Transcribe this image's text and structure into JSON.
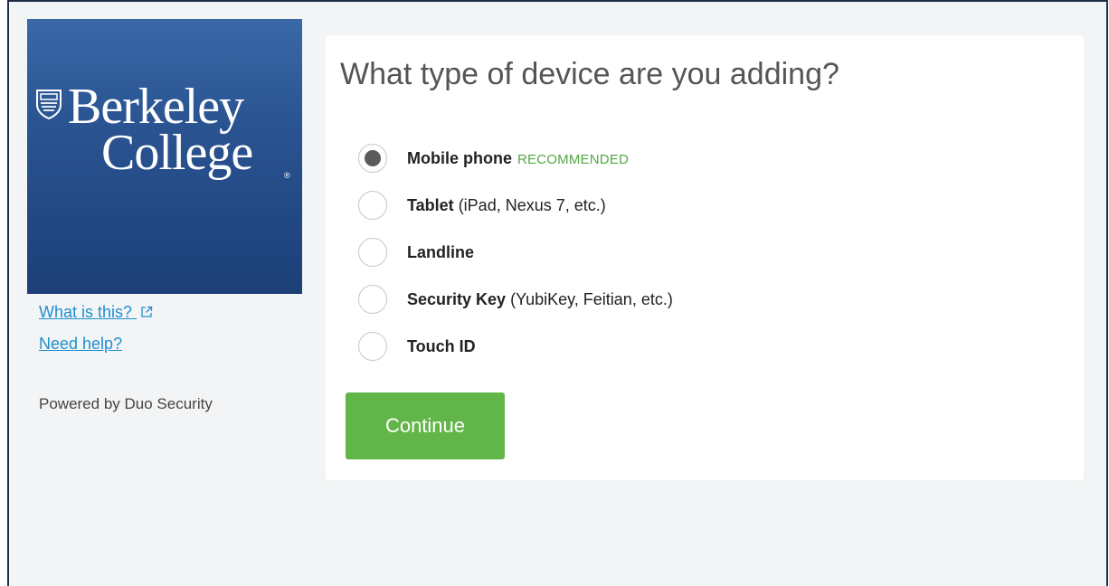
{
  "logo": {
    "line1": "Berkeley",
    "line2": "College",
    "registered_mark": "®",
    "brand_color": "#2b5593"
  },
  "sidebar": {
    "what_is_this": "What is this?",
    "need_help": "Need help?",
    "powered_by": "Powered by Duo Security"
  },
  "card": {
    "title": "What type of device are you adding?",
    "options": [
      {
        "name": "Mobile phone",
        "detail": "",
        "badge": "RECOMMENDED",
        "selected": true
      },
      {
        "name": "Tablet",
        "detail": "(iPad, Nexus 7, etc.)",
        "selected": false
      },
      {
        "name": "Landline",
        "detail": "",
        "selected": false
      },
      {
        "name": "Security Key",
        "detail": "(YubiKey, Feitian, etc.)",
        "selected": false
      },
      {
        "name": "Touch ID",
        "detail": "",
        "selected": false
      }
    ],
    "continue_label": "Continue"
  },
  "colors": {
    "accent_green": "#62b548",
    "recommended_green": "#52a843",
    "link_blue": "#1d8fd0",
    "frame_border": "#1f2f4a"
  },
  "icons": {
    "shield": "college-shield-icon",
    "external_link": "external-link-icon"
  }
}
